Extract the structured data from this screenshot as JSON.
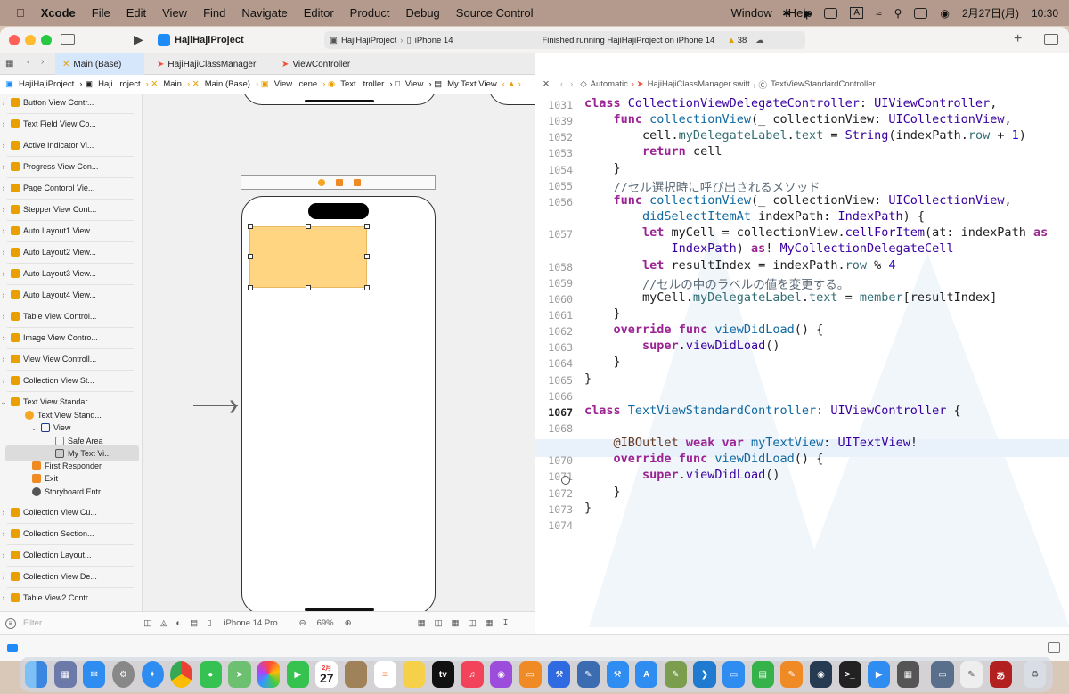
{
  "menubar": {
    "app": "Xcode",
    "items": [
      "File",
      "Edit",
      "View",
      "Find",
      "Navigate",
      "Editor",
      "Product",
      "Debug",
      "Source Control",
      "Window",
      "Help"
    ],
    "date": "2月27日(月)",
    "time": "10:30",
    "input_mode": "A"
  },
  "toolbar": {
    "project": "HajiHajiProject",
    "scheme": "HajiHajiProject",
    "device": "iPhone 14",
    "status": "Finished running HajiHajiProject on iPhone 14",
    "warnings": "38"
  },
  "tabs": [
    "Main (Base)",
    "HajiHajiClassManager",
    "ViewController"
  ],
  "jumpbar": [
    "HajiHajiProject",
    "Haji...roject",
    "Main",
    "Main (Base)",
    "View...cene",
    "Text...troller",
    "View",
    "My Text View"
  ],
  "sidebar": {
    "items": [
      "Button View Contr...",
      "Text Field View Co...",
      "Active Indicator Vi...",
      "Progress View Con...",
      "Page Contorol Vie...",
      "Stepper View Cont...",
      "Auto Layout1 View...",
      "Auto Layout2 View...",
      "Auto Layout3 View...",
      "Auto Layout4 View...",
      "Table View Control...",
      "Image View Contro...",
      "View View Controll...",
      "Collection View St...",
      "Text View Standar..."
    ],
    "tree": [
      "Text View Stand...",
      "View",
      "Safe Area",
      "My Text Vi...",
      "First Responder",
      "Exit",
      "Storyboard Entr..."
    ],
    "items2": [
      "Collection View Cu...",
      "Collection Section...",
      "Collection Layout...",
      "Collection View De...",
      "Table View2 Contr..."
    ],
    "filter_placeholder": "Filter"
  },
  "canvas": {
    "device": "iPhone 14 Pro",
    "zoom": "69%"
  },
  "editor": {
    "jump": [
      "Automatic",
      "HajiHajiClassManager.swift",
      "TextViewStandardController"
    ]
  },
  "code_lines": [
    {
      "n": "1031",
      "html": "<span class='kw'>class</span> <span class='ty'>CollectionViewDelegateController</span>: <span class='ty'>UIViewController</span>,"
    },
    {
      "n": "1039",
      "html": "    <span class='kw'>func</span> <span class='fn'>collectionView</span>(_ collectionView: <span class='ty'>UICollectionView</span>,"
    },
    {
      "n": "1052",
      "html": "        cell.<span class='pr'>myDelegateLabel</span>.<span class='pr'>text</span> = <span class='ty'>String</span>(indexPath.<span class='pr'>row</span> + <span class='nu'>1</span>)"
    },
    {
      "n": "1053",
      "html": "        <span class='kw'>return</span> cell"
    },
    {
      "n": "1054",
      "html": "    }"
    },
    {
      "n": "1055",
      "html": "    <span class='cm'>//セル選択時に呼び出されるメソッド</span>"
    },
    {
      "n": "1056",
      "html": "    <span class='kw'>func</span> <span class='fn'>collectionView</span>(_ collectionView: <span class='ty'>UICollectionView</span>,"
    },
    {
      "n": "",
      "html": "        <span class='fn'>didSelectItemAt</span> indexPath: <span class='ty'>IndexPath</span>) {"
    },
    {
      "n": "1057",
      "html": "        <span class='kw'>let</span> myCell = collectionView.<span class='ty'>cellForItem</span>(at: indexPath <span class='kw'>as</span>"
    },
    {
      "n": "",
      "html": "            <span class='ty'>IndexPath</span>) <span class='kw'>as</span>! <span class='ty'>MyCollectionDelegateCell</span>"
    },
    {
      "n": "1058",
      "html": "        <span class='kw'>let</span> resultIndex = indexPath.<span class='pr'>row</span> % <span class='nu'>4</span>"
    },
    {
      "n": "1059",
      "html": "        <span class='cm'>//セルの中のラベルの値を変更する。</span>"
    },
    {
      "n": "1060",
      "html": "        myCell.<span class='pr'>myDelegateLabel</span>.<span class='pr'>text</span> = <span class='pr'>member</span>[resultIndex]"
    },
    {
      "n": "1061",
      "html": "    }"
    },
    {
      "n": "1062",
      "html": "    <span class='kw'>override</span> <span class='kw'>func</span> <span class='fn'>viewDidLoad</span>() {"
    },
    {
      "n": "1063",
      "html": "        <span class='kw'>super</span>.<span class='ty'>viewDidLoad</span>()"
    },
    {
      "n": "1064",
      "html": "    }"
    },
    {
      "n": "1065",
      "html": "}"
    },
    {
      "n": "1066",
      "html": ""
    },
    {
      "n": "1067",
      "html": "<span class='kw'>class</span> <span class='fn'>TextViewStandardController</span>: <span class='ty'>UIViewController</span> {"
    },
    {
      "n": "1068",
      "html": ""
    },
    {
      "n": "",
      "html": "    <span class='at'>@IBOutlet</span> <span class='kw'>weak</span> <span class='kw'>var</span> <span class='fn'>myTextView</span>: <span class='ty'>UITextView</span>!"
    },
    {
      "n": "1070",
      "html": "    <span class='kw'>override</span> <span class='kw'>func</span> <span class='fn'>viewDidLoad</span>() {"
    },
    {
      "n": "1071",
      "html": "        <span class='kw'>super</span>.<span class='ty'>viewDidLoad</span>()"
    },
    {
      "n": "1072",
      "html": "    }"
    },
    {
      "n": "1073",
      "html": "}"
    },
    {
      "n": "1074",
      "html": ""
    }
  ],
  "dock": [
    "Finder",
    "Launchpad",
    "Mail",
    "System Settings",
    "Safari",
    "Chrome",
    "Messages",
    "Maps",
    "Photos",
    "FaceTime",
    "Calendar",
    "Notes",
    "Reminders",
    "Stickies",
    "TV",
    "Music",
    "Podcasts",
    "Books",
    "Xcode",
    "Preview",
    "Simulator",
    "App Store",
    "Script",
    "VS Code",
    "Keynote",
    "Numbers",
    "Pages",
    "Activity",
    "Terminal",
    "Zoom",
    "Calculator",
    "Simulator2",
    "TextEdit",
    "Dictionary",
    "Trash"
  ],
  "dock_calendar_month": "2月",
  "dock_calendar_day": "27",
  "dock_dictionary_label": "あ",
  "dock_terminal_label": ">_"
}
